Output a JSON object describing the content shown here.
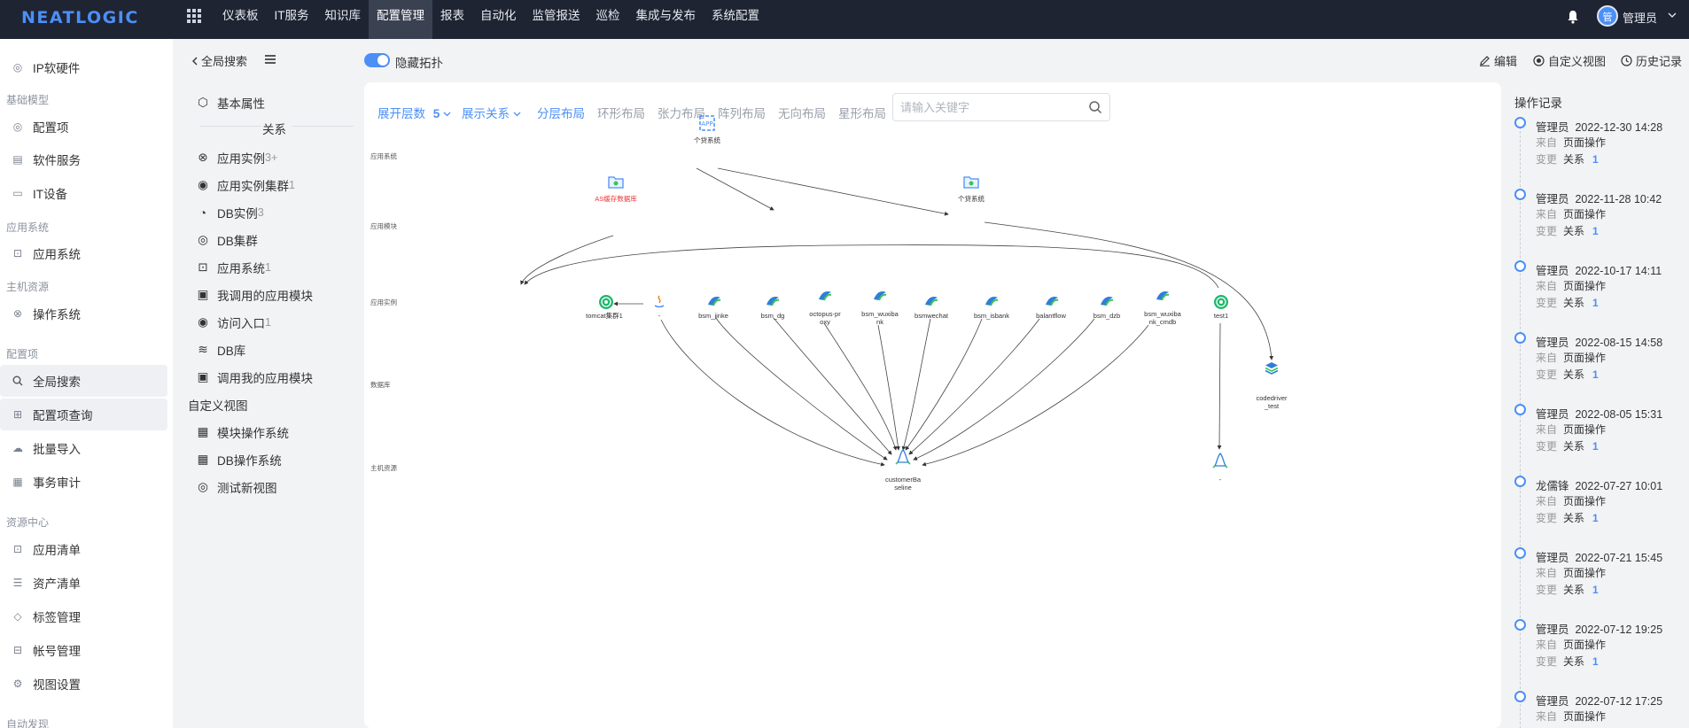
{
  "app": {
    "logo": "NEATLOGIC",
    "nav": [
      "仪表板",
      "IT服务",
      "知识库",
      "配置管理",
      "报表",
      "自动化",
      "监管报送",
      "巡检",
      "集成与发布",
      "系统配置"
    ],
    "active_nav": "配置管理",
    "user": "管理员",
    "avatar_text": "管"
  },
  "sidebar": {
    "groups": {
      "base_model": "基础模型",
      "app_system": "应用系统",
      "host_resource": "主机资源",
      "config_item": "配置项",
      "resource_center": "资源中心",
      "auto_discovery": "自动发现"
    },
    "items": {
      "ip_hardware": "IP软硬件",
      "config_item": "配置项",
      "software_service": "软件服务",
      "it_device": "IT设备",
      "app_system": "应用系统",
      "os": "操作系统",
      "global_search": "全局搜索",
      "ci_query": "配置项查询",
      "batch_import": "批量导入",
      "audit": "事务审计",
      "app_list": "应用清单",
      "asset_list": "资产清单",
      "tag_mgmt": "标签管理",
      "account_mgmt": "帐号管理",
      "view_settings": "视图设置"
    }
  },
  "detail_nav": {
    "back_label": "全局搜索",
    "basic_attr": "基本属性",
    "relations_title": "关系",
    "relations": [
      {
        "label": "应用实例",
        "count": "3+"
      },
      {
        "label": "应用实例集群",
        "count": "1"
      },
      {
        "label": "DB实例",
        "count": "3"
      },
      {
        "label": "DB集群",
        "count": ""
      },
      {
        "label": "应用系统",
        "count": "1"
      },
      {
        "label": "我调用的应用模块",
        "count": ""
      },
      {
        "label": "访问入口",
        "count": "1"
      },
      {
        "label": "DB库",
        "count": ""
      },
      {
        "label": "调用我的应用模块",
        "count": ""
      }
    ],
    "custom_views_title": "自定义视图",
    "custom_views": [
      "模块操作系统",
      "DB操作系统",
      "测试新视图"
    ]
  },
  "toolbar": {
    "hide_topology": "隐藏拓扑",
    "edit": "编辑",
    "custom_view": "自定义视图",
    "history": "历史记录"
  },
  "topology": {
    "expand_levels_label": "展开层数",
    "expand_levels_value": "5",
    "show_relations_label": "展示关系",
    "layouts": [
      "分层布局",
      "环形布局",
      "张力布局",
      "阵列布局",
      "无向布局",
      "星形布局"
    ],
    "active_layout": "分层布局",
    "search_placeholder": "请输入关键字",
    "layers": [
      "应用系统",
      "应用模块",
      "应用实例",
      "数据库",
      "主机资源"
    ],
    "nodes": {
      "sys": "个贷系统",
      "mod_as": "AS缓存数据库",
      "mod_gd": "个贷系统",
      "tomcat": "tomcat集群1",
      "java": "-",
      "bsm_jinke": "bsm_jinke",
      "bsm_dg": "bsm_dg",
      "octopus_1": "octopus-pr",
      "octopus_2": "oxy",
      "wuxibank_1": "bsm_wuxiba",
      "wuxibank_2": "nk",
      "bsmwechat": "bsmwechat",
      "bsm_isbank": "bsm_isbank",
      "balantflow": "balantflow",
      "bsm_dzb": "bsm_dzb",
      "wuxi_cmdb_1": "bsm_wuxiba",
      "wuxi_cmdb_2": "nk_cmdb",
      "test1": "test1",
      "codedriver_1": "codedriver",
      "codedriver_2": "_test",
      "baseline_1": "customerBa",
      "baseline_2": "seline",
      "linux2": "-"
    },
    "colors": {
      "accent": "#4b8ff7",
      "alert": "#e33333",
      "topbar": "#1f2433"
    }
  },
  "history": {
    "title": "操作记录",
    "from_label": "来自",
    "change_label": "变更",
    "entries": [
      {
        "user": "管理员",
        "time": "2022-12-30 14:28",
        "from": "页面操作",
        "change": "关系",
        "count": "1"
      },
      {
        "user": "管理员",
        "time": "2022-11-28 10:42",
        "from": "页面操作",
        "change": "关系",
        "count": "1"
      },
      {
        "user": "管理员",
        "time": "2022-10-17 14:11",
        "from": "页面操作",
        "change": "关系",
        "count": "1"
      },
      {
        "user": "管理员",
        "time": "2022-08-15 14:58",
        "from": "页面操作",
        "change": "关系",
        "count": "1"
      },
      {
        "user": "管理员",
        "time": "2022-08-05 15:31",
        "from": "页面操作",
        "change": "关系",
        "count": "1"
      },
      {
        "user": "龙儒锋",
        "time": "2022-07-27 10:01",
        "from": "页面操作",
        "change": "关系",
        "count": "1"
      },
      {
        "user": "管理员",
        "time": "2022-07-21 15:45",
        "from": "页面操作",
        "change": "关系",
        "count": "1"
      },
      {
        "user": "管理员",
        "time": "2022-07-12 19:25",
        "from": "页面操作",
        "change": "关系",
        "count": "1"
      },
      {
        "user": "管理员",
        "time": "2022-07-12 17:25",
        "from": "页面操作",
        "change": "",
        "count": ""
      }
    ]
  }
}
